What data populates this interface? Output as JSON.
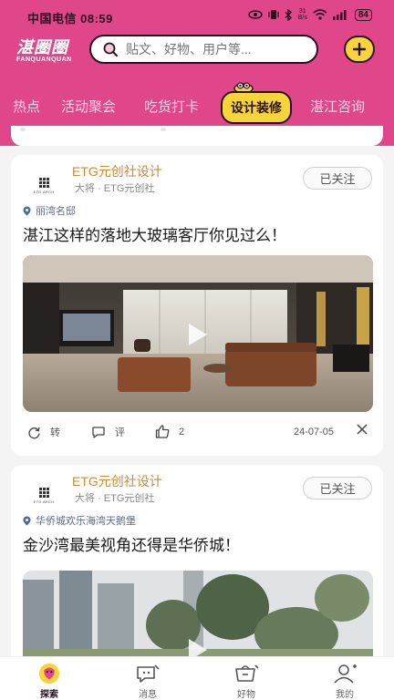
{
  "status_bar": {
    "carrier_time": "中国电信 08:59",
    "net_speed_top": "31",
    "net_speed_bottom": "B/s",
    "battery": "84"
  },
  "header": {
    "logo_cn": "湛圈圈",
    "logo_en": "FANQUANQUAN",
    "search_placeholder": "贴文、好物、用户等..."
  },
  "tabs": [
    {
      "label": "热点"
    },
    {
      "label": "活动聚会"
    },
    {
      "label": "吃货打卡"
    },
    {
      "label": "设计装修",
      "active": true
    },
    {
      "label": "湛江咨询"
    }
  ],
  "posts": [
    {
      "author": "ETG元创社设计",
      "rank": "大将",
      "org": "· ETG元创社",
      "avatar_text": "ETG  ARCH",
      "follow_label": "已关注",
      "location": "丽湾名邸",
      "title": "湛江这样的落地大玻璃客厅你见过么！",
      "actions": {
        "repost": "转",
        "comment": "评",
        "likes": "2"
      },
      "date": "24-07-05"
    },
    {
      "author": "ETG元创社设计",
      "rank": "大将",
      "org": "· ETG元创社",
      "avatar_text": "ETG  ARCH",
      "follow_label": "已关注",
      "location": "华侨城欢乐海湾天鹅堡",
      "title": "金沙湾最美视角还得是华侨城！"
    }
  ],
  "bottom_nav": [
    {
      "label": "探索",
      "active": true
    },
    {
      "label": "消息"
    },
    {
      "label": "好物"
    },
    {
      "label": "我的"
    }
  ],
  "colors": {
    "brand_pink": "#e0468a",
    "accent_yellow": "#f6d43a",
    "author_gold": "#c98a3a"
  }
}
